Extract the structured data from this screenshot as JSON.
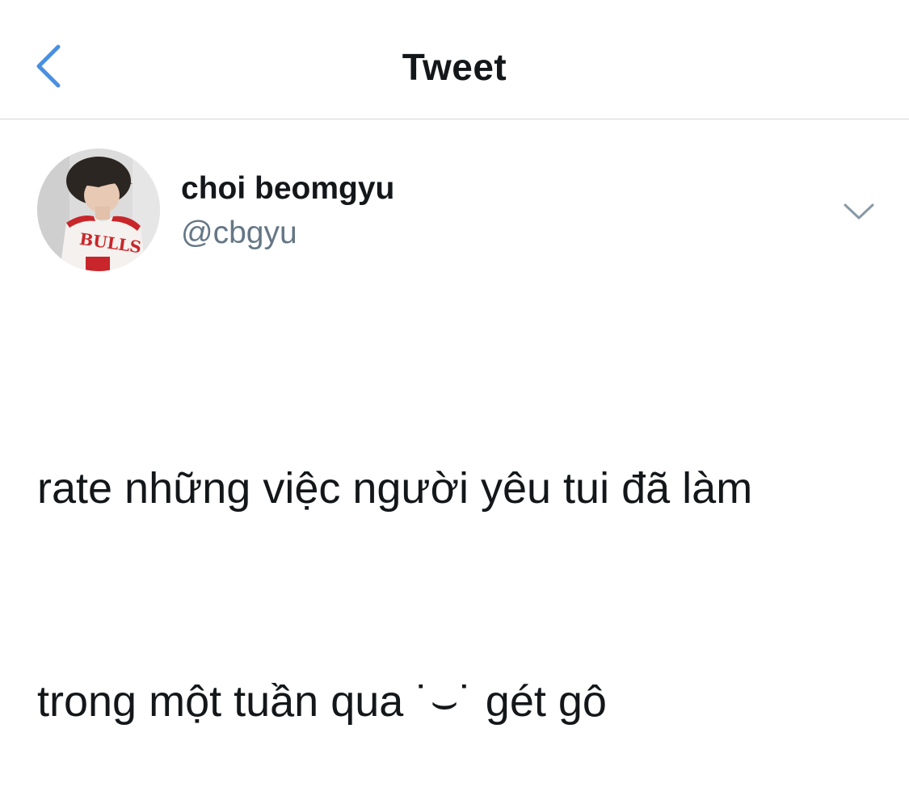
{
  "header": {
    "title": "Tweet",
    "back_icon": "chevron-left-icon",
    "accent_color": "#4a90e2"
  },
  "tweet": {
    "author": {
      "display_name": "choi beomgyu",
      "handle": "@cbgyu",
      "avatar_icon": "avatar-photo",
      "avatar_jersey_text": "BULLS"
    },
    "more_icon": "chevron-down-icon",
    "text_line_1": "rate những việc người yêu tui đã làm",
    "text_line_2": "trong một tuần qua ˙⌣˙ gét gô"
  }
}
